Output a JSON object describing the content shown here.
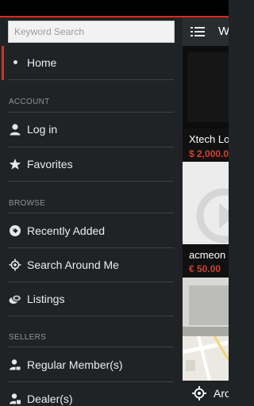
{
  "search": {
    "placeholder": "Keyword Search",
    "value": ""
  },
  "nav": {
    "home": {
      "label": "Home",
      "icon": "bullet-dot"
    },
    "account_title": "ACCOUNT",
    "account": [
      {
        "label": "Log in",
        "icon": "person-icon"
      },
      {
        "label": "Favorites",
        "icon": "star-icon"
      }
    ],
    "browse_title": "BROWSE",
    "browse": [
      {
        "label": "Recently Added",
        "icon": "tag-icon"
      },
      {
        "label": "Search Around Me",
        "icon": "location-target-icon"
      },
      {
        "label": "Listings",
        "icon": "coins-icon"
      }
    ],
    "sellers_title": "SELLERS",
    "sellers": [
      {
        "label": "Regular Member(s)",
        "icon": "member-icon"
      },
      {
        "label": "Dealer(s)",
        "icon": "dealer-icon"
      }
    ]
  },
  "background": {
    "header_title": "W",
    "listings": [
      {
        "title": "Xtech Lo",
        "price": "$ 2,000.0"
      },
      {
        "title": "acmeon",
        "price": "€ 50.00"
      }
    ],
    "bottom_label": "Aro"
  },
  "colors": {
    "accent": "#c0392b",
    "price": "#d2402e",
    "drawer_bg": "#1f2326"
  }
}
